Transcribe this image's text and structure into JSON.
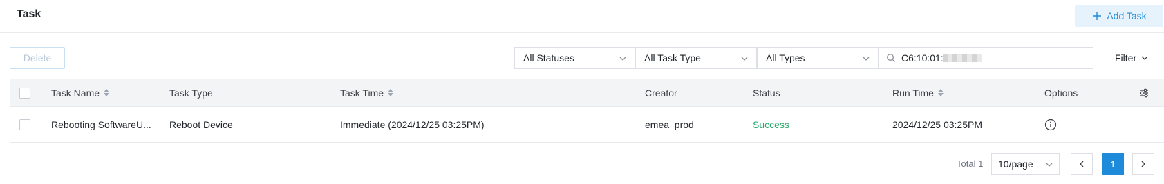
{
  "header": {
    "title": "Task",
    "add_button_label": "Add Task"
  },
  "toolbar": {
    "delete_label": "Delete",
    "status_filter": "All Statuses",
    "task_type_filter": "All Task Type",
    "type_filter": "All Types",
    "search_value": "C6:10:01:",
    "filter_label": "Filter"
  },
  "table": {
    "columns": {
      "task_name": "Task Name",
      "task_type": "Task Type",
      "task_time": "Task Time",
      "creator": "Creator",
      "status": "Status",
      "run_time": "Run Time",
      "options": "Options"
    },
    "rows": [
      {
        "task_name": "Rebooting SoftwareU...",
        "task_type": "Reboot Device",
        "task_time": "Immediate (2024/12/25 03:25PM)",
        "creator": "emea_prod",
        "status": "Success",
        "run_time": "2024/12/25 03:25PM"
      }
    ]
  },
  "pagination": {
    "total_text": "Total 1",
    "page_size": "10/page",
    "current_page": "1"
  },
  "colors": {
    "accent": "#1e8bda",
    "success": "#27a96c"
  },
  "icons": [
    "plus-icon",
    "chevron-down-icon",
    "search-icon",
    "sort-icon",
    "column-settings-icon",
    "info-icon",
    "chevron-left-icon",
    "chevron-right-icon"
  ]
}
